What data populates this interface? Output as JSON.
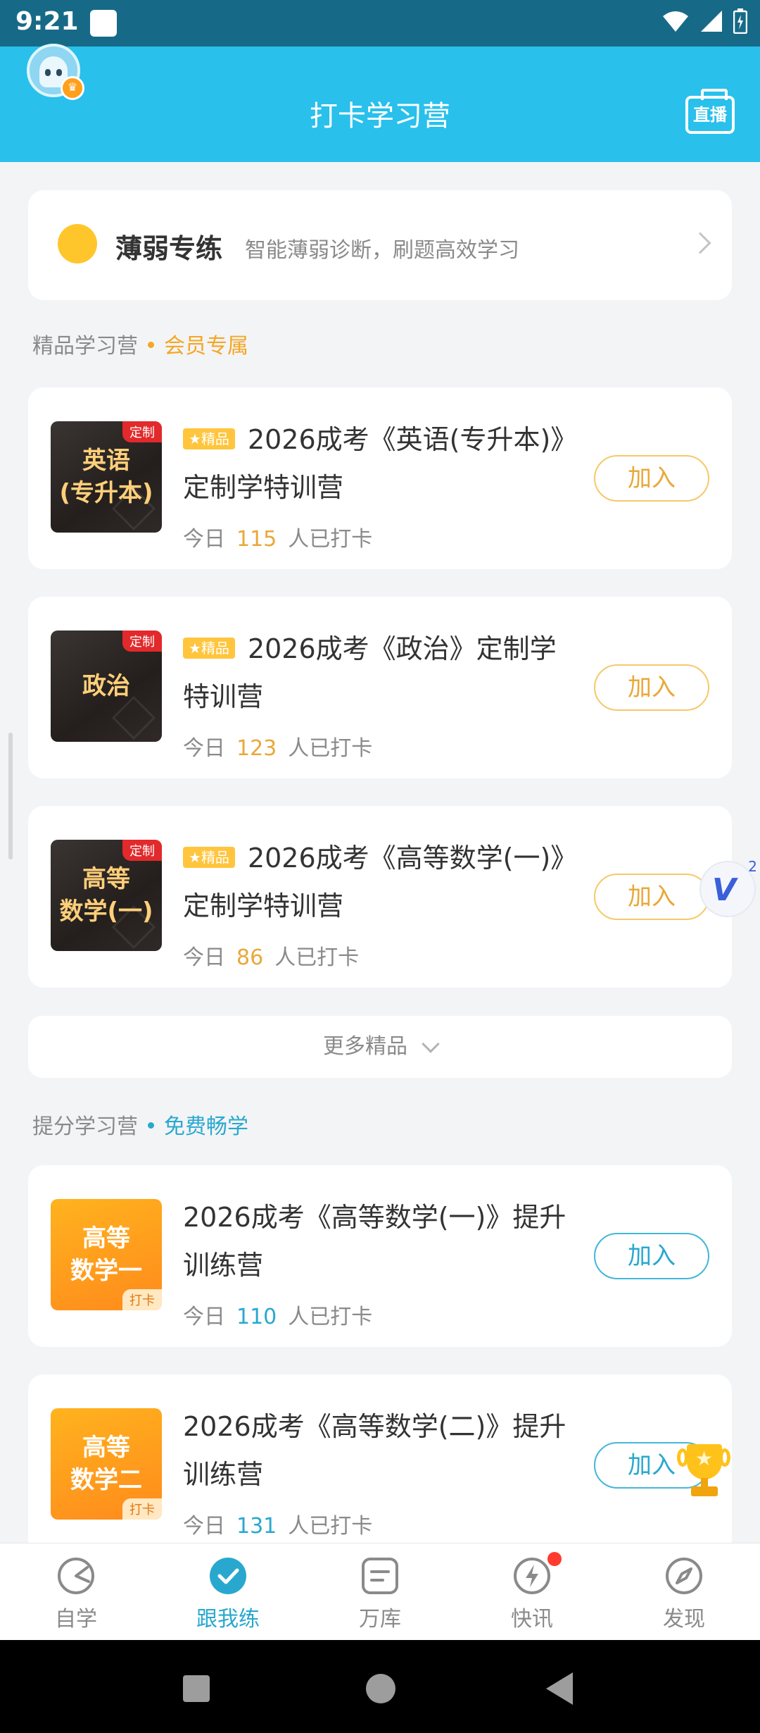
{
  "status_bar": {
    "time": "9:21"
  },
  "header": {
    "title": "打卡学习营",
    "live_label": "直播"
  },
  "weak_practice": {
    "title": "薄弱专练",
    "subtitle": "智能薄弱诊断，刷题高效学习"
  },
  "premium_section": {
    "title": "精品学习营",
    "tag": "会员专属",
    "tag_color": "#f5a623"
  },
  "premium_camps": [
    {
      "cover_text": "英语\n(专升本)",
      "cover_badge": "定制",
      "badge": "精品",
      "title": "2026成考《英语(专升本)》定制学特训营",
      "prefix": "今日",
      "count": "115",
      "suffix": "人已打卡",
      "join_label": "加入"
    },
    {
      "cover_text": "政治",
      "cover_badge": "定制",
      "badge": "精品",
      "title": "2026成考《政治》定制学特训营",
      "prefix": "今日",
      "count": "123",
      "suffix": "人已打卡",
      "join_label": "加入"
    },
    {
      "cover_text": "高等\n数学(一)",
      "cover_badge": "定制",
      "badge": "精品",
      "title": "2026成考《高等数学(一)》定制学特训营",
      "prefix": "今日",
      "count": "86",
      "suffix": "人已打卡",
      "join_label": "加入"
    }
  ],
  "more_label": "更多精品",
  "free_section": {
    "title": "提分学习营",
    "tag": "免费畅学",
    "tag_color": "#29a8cf"
  },
  "free_camps": [
    {
      "cover_text": "高等\n数学一",
      "cover_badge": "打卡",
      "title": "2026成考《高等数学(一)》提升训练营",
      "prefix": "今日",
      "count": "110",
      "suffix": "人已打卡",
      "join_label": "加入"
    },
    {
      "cover_text": "高等\n数学二",
      "cover_badge": "打卡",
      "title": "2026成考《高等数学(二)》提升训练营",
      "prefix": "今日",
      "count": "131",
      "suffix": "人已打卡",
      "join_label": "加入"
    }
  ],
  "floating_v": {
    "mark": "V",
    "count": "2"
  },
  "tabs": [
    {
      "label": "自学",
      "icon": "self-study-icon"
    },
    {
      "label": "跟我练",
      "icon": "check-circle-icon"
    },
    {
      "label": "万库",
      "icon": "library-icon"
    },
    {
      "label": "快讯",
      "icon": "lightning-icon"
    },
    {
      "label": "发现",
      "icon": "compass-icon"
    }
  ],
  "colors": {
    "header": "#29c0ec",
    "accent": "#29a8cf",
    "gold": "#e9a83a"
  }
}
